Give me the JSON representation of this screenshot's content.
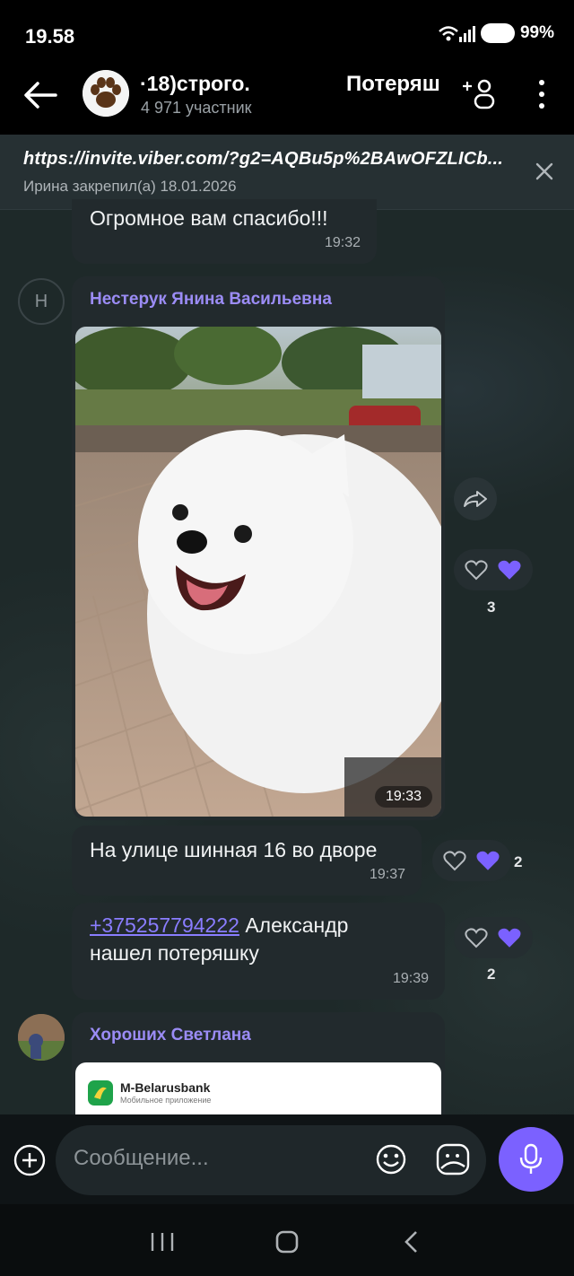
{
  "status_bar": {
    "time": "19.58",
    "battery": "99%"
  },
  "header": {
    "group_name": "·18)строго.",
    "members": "4 971 участник",
    "group_name_secondary": "Потеряш"
  },
  "pinned": {
    "link": "https://invite.viber.com/?g2=AQBu5p%2BAwOFZLICb...",
    "pinned_by": "Ирина закрепил(а) 18.01.2026"
  },
  "messages": [
    {
      "text": "Огромное вам спасибо!!!",
      "time": "19:32"
    },
    {
      "sender": "Нестерук Янина Васильевна",
      "avatar_letter": "Н",
      "photo_time": "19:33",
      "reactions": {
        "count": "3"
      }
    },
    {
      "text": "На улице шинная 16 во дворе",
      "time": "19:37",
      "reactions": {
        "count": "2"
      }
    },
    {
      "mention": "+375257794222",
      "text_after": " Александр",
      "text_line2": "нашел потеряшку",
      "time": "19:39",
      "reactions": {
        "count": "2"
      }
    },
    {
      "sender": "Хороших Светлана",
      "card_title": "M-Belarusbank",
      "card_subtitle": "Мобильное приложение"
    }
  ],
  "compose": {
    "placeholder": "Сообщение..."
  },
  "colors": {
    "accent": "#7b61ff",
    "sender": "#9b8cf5",
    "bubble": "#222a2d"
  }
}
